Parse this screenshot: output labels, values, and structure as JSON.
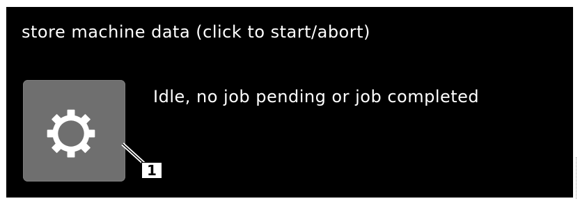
{
  "panel": {
    "title": "store machine data (click to start/abort)",
    "background": "#000000"
  },
  "job_button": {
    "icon": "gear-icon",
    "color": "#6f6f6f"
  },
  "status": {
    "text": "Idle, no job pending or job completed"
  },
  "callout": {
    "label": "1"
  }
}
